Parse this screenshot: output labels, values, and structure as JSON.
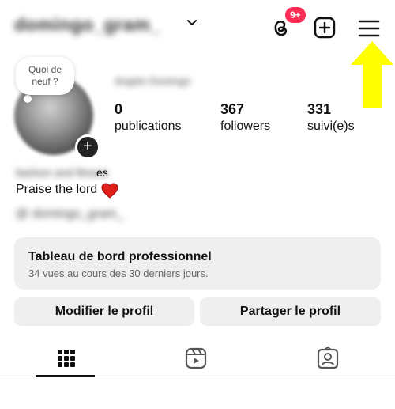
{
  "header": {
    "username": "domingo_gram_",
    "notifications_badge": "9+"
  },
  "note": {
    "text": "Quoi de neuf ?"
  },
  "profile": {
    "display_name": "Angelo Domingo",
    "stats": [
      {
        "value": "0",
        "label": "publications"
      },
      {
        "value": "367",
        "label": "followers"
      },
      {
        "value": "331",
        "label": "suivi(e)s"
      }
    ],
    "bio_category": "fashion and fitness",
    "bio_category_tail": "es",
    "bio_text": "Praise the lord",
    "handle": "@ domingo_gram_"
  },
  "dashboard": {
    "title": "Tableau de bord professionnel",
    "subtitle": "34 vues au cours des 30 derniers jours."
  },
  "actions": {
    "edit_label": "Modifier le profil",
    "share_label": "Partager le profil"
  },
  "tabs": [
    "grid-icon",
    "reels-icon",
    "tagged-icon"
  ],
  "colors": {
    "badge": "#ff2d55",
    "annotation_arrow": "#ffff00",
    "button_bg": "#efefef"
  }
}
